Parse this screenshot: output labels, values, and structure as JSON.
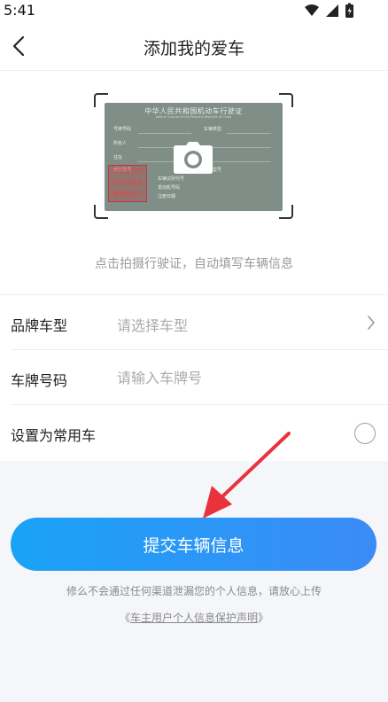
{
  "status_bar": {
    "time": "5:41",
    "icons": [
      "wifi-icon",
      "signal-icon",
      "battery-icon"
    ]
  },
  "header": {
    "title": "添加我的爱车",
    "back_icon": "chevron-left-icon"
  },
  "upload": {
    "license_title": "中华人民共和国机动车行驶证",
    "license_subtitle": "Vehicle License of the People's Republic of China",
    "license_fields": [
      "号牌号码",
      "车辆类型",
      "所有人",
      "住址",
      "使用性质",
      "品牌型号",
      "车辆识别代号",
      "发动机号码",
      "注册日期"
    ],
    "stamp_lines": [
      "河南省郑州",
      "市公安局交",
      "通警察支队"
    ],
    "camera_icon": "camera-icon",
    "hint": "点击拍摄行驶证，自动填写车辆信息"
  },
  "form": {
    "brand_label": "品牌车型",
    "brand_placeholder": "请选择车型",
    "plate_label": "车牌号码",
    "plate_placeholder": "请输入车牌号",
    "default_label": "设置为常用车",
    "default_selected": false
  },
  "submit": {
    "label": "提交车辆信息"
  },
  "privacy": {
    "note": "修么不会通过任何渠道泄漏您的个人信息，请放心上传",
    "link_open": "《",
    "link_text": "车主用户个人信息保护声明",
    "link_close": "》"
  },
  "colors": {
    "accent_start": "#1aa3f6",
    "accent_end": "#3b8bf6",
    "annotation_arrow": "#e8333d"
  }
}
